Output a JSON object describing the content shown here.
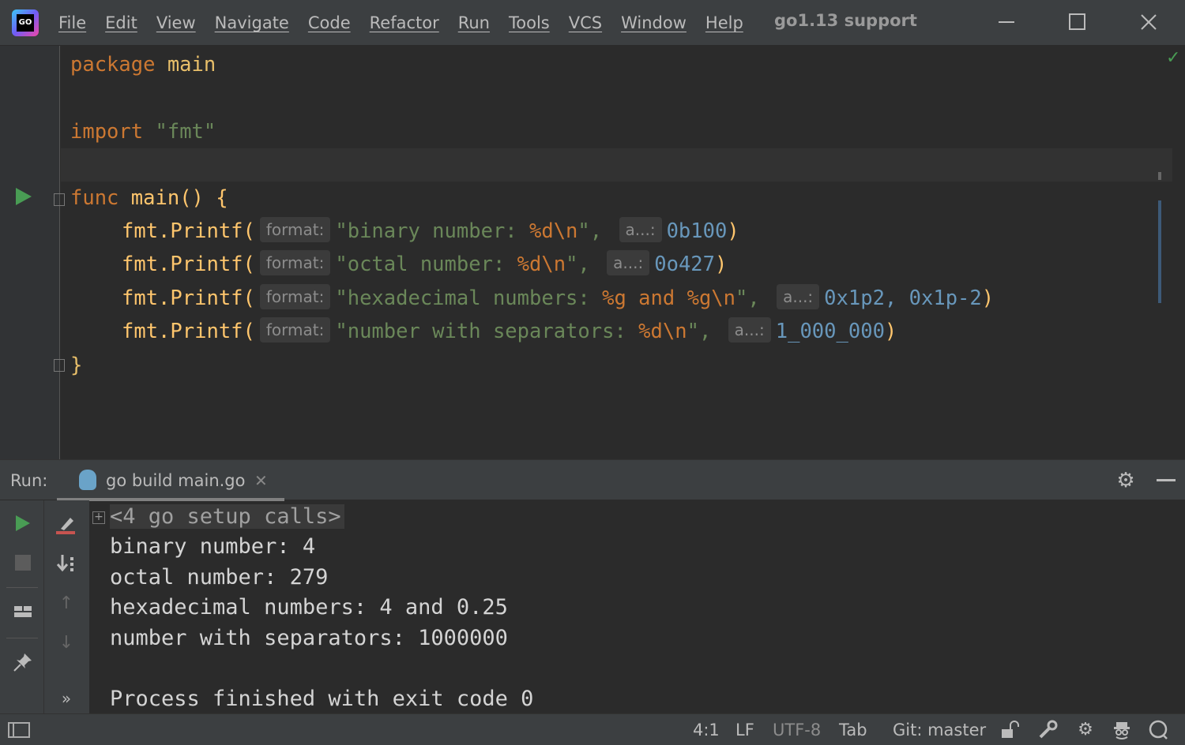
{
  "titlebar": {
    "logo_text": "GO",
    "menu": [
      "File",
      "Edit",
      "View",
      "Navigate",
      "Code",
      "Refactor",
      "Run",
      "Tools",
      "VCS",
      "Window",
      "Help"
    ],
    "project_title": "go1.13 support"
  },
  "editor": {
    "line_package_kw": "package",
    "line_package_name": "main",
    "line_import_kw": "import",
    "line_import_path": "\"fmt\"",
    "func_kw": "func",
    "func_sig": "main() {",
    "calls": [
      {
        "call": "fmt.Printf(",
        "format_hint": "format:",
        "format": "\"binary number: ",
        "verb": "%d\\n",
        "end_quote": "\",",
        "arg_hint": "a...:",
        "args": "0b100",
        "close": ")"
      },
      {
        "call": "fmt.Printf(",
        "format_hint": "format:",
        "format": "\"octal number: ",
        "verb": "%d\\n",
        "end_quote": "\",",
        "arg_hint": "a...:",
        "args": "0o427",
        "close": ")"
      },
      {
        "call": "fmt.Printf(",
        "format_hint": "format:",
        "format": "\"hexadecimal numbers: ",
        "verb": "%g and %g\\n",
        "end_quote": "\",",
        "arg_hint": "a...:",
        "args": "0x1p2, 0x1p-2",
        "close": ")"
      },
      {
        "call": "fmt.Printf(",
        "format_hint": "format:",
        "format": "\"number with separators: ",
        "verb": "%d\\n",
        "end_quote": "\",",
        "arg_hint": "a...:",
        "args": "1_000_000",
        "close": ")"
      }
    ],
    "closing_brace": "}"
  },
  "run_panel": {
    "label": "Run:",
    "tab_label": "go build main.go",
    "output": [
      "<4 go setup calls>",
      "binary number: 4",
      "octal number: 279",
      "hexadecimal numbers: 4 and 0.25",
      "number with separators: 1000000",
      "",
      "Process finished with exit code 0"
    ],
    "more_label": "»"
  },
  "statusbar": {
    "position": "4:1",
    "line_separator": "LF",
    "encoding": "UTF-8",
    "indent": "Tab",
    "vcs_branch": "Git: master"
  },
  "colors": {
    "run_green": "#499c54",
    "keyword": "#cc7832",
    "string": "#6a8759",
    "number": "#6897bb",
    "function": "#ffc66d"
  }
}
